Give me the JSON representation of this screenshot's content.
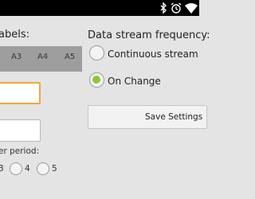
{
  "status_bar": {
    "icons": [
      "bluetooth-icon",
      "alarm-clock-icon",
      "wifi-icon"
    ]
  },
  "left_panel": {
    "title": "abels:",
    "analog_labels": [
      "A3",
      "A4",
      "A5"
    ],
    "period_label": "er period:",
    "period_options": [
      {
        "label": "3",
        "checked": false
      },
      {
        "label": "4",
        "checked": false
      },
      {
        "label": "5",
        "checked": false
      }
    ]
  },
  "right_panel": {
    "title": "Data stream frequency:",
    "options": [
      {
        "label": "Continuous stream",
        "checked": false
      },
      {
        "label": "On Change",
        "checked": true
      }
    ],
    "save_label": "Save Settings"
  },
  "colors": {
    "accent_green": "#90c53b",
    "focus_orange": "#f3a73a",
    "band_gray": "#9e9e9e",
    "background": "#e4e4e4"
  }
}
